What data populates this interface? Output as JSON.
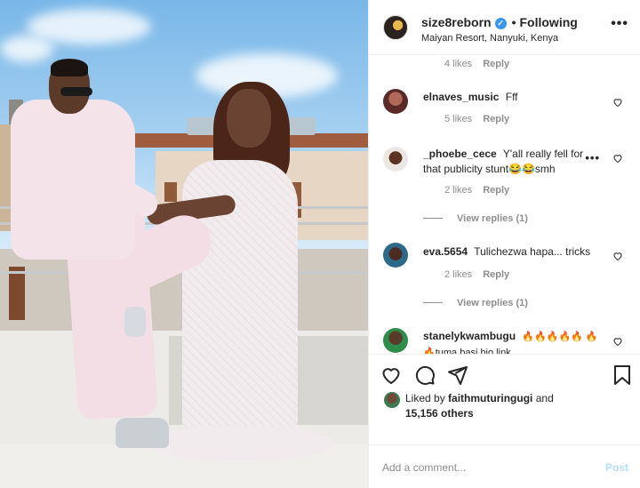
{
  "header": {
    "username": "size8reborn",
    "verified_mark": "✓",
    "separator": "•",
    "follow_state": "Following",
    "location": "Maiyan Resort, Nanyuki, Kenya",
    "more_icon": "•••"
  },
  "comments": {
    "partial_top": {
      "likes": "4 likes",
      "reply": "Reply"
    },
    "items": [
      {
        "username": "elnaves_music",
        "text": "Fff",
        "likes": "5 likes",
        "reply": "Reply"
      },
      {
        "username": "_phoebe_cece",
        "text": "Y'all really fell for that publicity stunt😂😂smh",
        "likes": "2 likes",
        "reply": "Reply",
        "more_icon": "•••",
        "view_replies": "View replies (1)"
      },
      {
        "username": "eva.5654",
        "text": "Tulichezwa hapa... tricks",
        "likes": "2 likes",
        "reply": "Reply",
        "view_replies": "View replies (1)"
      },
      {
        "username": "stanelykwambugu",
        "text": "🔥🔥🔥🔥🔥 🔥🔥tuma basi hio link",
        "likes": "",
        "reply": ""
      }
    ]
  },
  "likes": {
    "prefix": "Liked by",
    "user": "faithmuturingugi",
    "and": "and",
    "others": "15,156 others"
  },
  "add_comment": {
    "placeholder": "Add a comment...",
    "post_label": "Post"
  },
  "icons": {
    "like": "heart-icon",
    "comment": "comment-icon",
    "share": "share-icon",
    "save": "bookmark-icon"
  },
  "colors": {
    "verified": "#3897f0",
    "post_disabled": "#b2dffc",
    "secondary_text": "#8e8e8e"
  }
}
